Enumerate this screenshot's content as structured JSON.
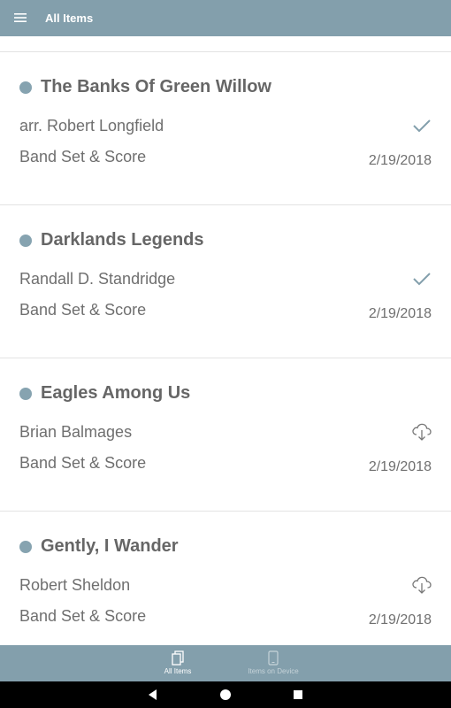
{
  "appbar": {
    "title": "All Items",
    "menu_icon": "hamburger-menu-icon"
  },
  "items": [
    {
      "title": "The Banks Of Green Willow",
      "composer": "arr. Robert Longfield",
      "format": "Band Set & Score",
      "date": "2/19/2018",
      "status": "downloaded"
    },
    {
      "title": "Darklands Legends",
      "composer": "Randall D. Standridge",
      "format": "Band Set & Score",
      "date": "2/19/2018",
      "status": "downloaded"
    },
    {
      "title": "Eagles Among Us",
      "composer": "Brian Balmages",
      "format": "Band Set & Score",
      "date": "2/19/2018",
      "status": "cloud"
    },
    {
      "title": "Gently, I Wander",
      "composer": "Robert Sheldon",
      "format": "Band Set & Score",
      "date": "2/19/2018",
      "status": "cloud"
    }
  ],
  "bottom_nav": {
    "all_items": "All Items",
    "items_on_device": "Items on Device"
  },
  "colors": {
    "accent": "#839fac",
    "dot": "#86a3b0",
    "text": "#6f6f6f"
  }
}
